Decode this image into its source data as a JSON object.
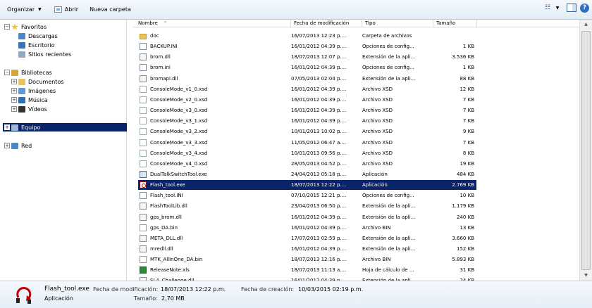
{
  "toolbar": {
    "organize": "Organizar",
    "open": "Abrir",
    "new_folder": "Nueva carpeta"
  },
  "nav": {
    "favorites": "Favoritos",
    "downloads": "Descargas",
    "desktop": "Escritorio",
    "recent": "Sitios recientes",
    "libraries": "Bibliotecas",
    "documents": "Documentos",
    "images": "Imágenes",
    "music": "Música",
    "videos": "Vídeos",
    "computer": "Equipo",
    "network": "Red"
  },
  "columns": {
    "name": "Nombre",
    "date": "Fecha de modificación",
    "type": "Tipo",
    "size": "Tamaño"
  },
  "files": [
    {
      "name": "doc",
      "date": "16/07/2013 12:23 p....",
      "type": "Carpeta de archivos",
      "size": "",
      "icon": "folder-icon"
    },
    {
      "name": "BACKUP.INI",
      "date": "16/01/2012 04:39 p....",
      "type": "Opciones de config...",
      "size": "1 KB",
      "icon": "ini-file-icon"
    },
    {
      "name": "brom.dll",
      "date": "18/07/2013 12:07 p....",
      "type": "Extensión de la apli...",
      "size": "3.536 KB",
      "icon": "dll-file-icon"
    },
    {
      "name": "brom.ini",
      "date": "16/01/2012 04:39 p....",
      "type": "Opciones de config...",
      "size": "1 KB",
      "icon": "ini-file-icon"
    },
    {
      "name": "bromapi.dll",
      "date": "07/05/2013 02:04 p....",
      "type": "Extensión de la apli...",
      "size": "88 KB",
      "icon": "dll-file-icon"
    },
    {
      "name": "ConsoleMode_v1_0.xsd",
      "date": "16/01/2012 04:39 p....",
      "type": "Archivo XSD",
      "size": "12 KB",
      "icon": "xsd-file-icon"
    },
    {
      "name": "ConsoleMode_v2_0.xsd",
      "date": "16/01/2012 04:39 p....",
      "type": "Archivo XSD",
      "size": "7 KB",
      "icon": "xsd-file-icon"
    },
    {
      "name": "ConsoleMode_v3_0.xsd",
      "date": "16/01/2012 04:39 p....",
      "type": "Archivo XSD",
      "size": "7 KB",
      "icon": "xsd-file-icon"
    },
    {
      "name": "ConsoleMode_v3_1.xsd",
      "date": "16/01/2012 04:39 p....",
      "type": "Archivo XSD",
      "size": "7 KB",
      "icon": "xsd-file-icon"
    },
    {
      "name": "ConsoleMode_v3_2.xsd",
      "date": "10/01/2013 10:02 p....",
      "type": "Archivo XSD",
      "size": "9 KB",
      "icon": "xsd-file-icon"
    },
    {
      "name": "ConsoleMode_v3_3.xsd",
      "date": "11/05/2012 06:47 a....",
      "type": "Archivo XSD",
      "size": "7 KB",
      "icon": "xsd-file-icon"
    },
    {
      "name": "ConsoleMode_v3_4.xsd",
      "date": "10/01/2013 09:56 p....",
      "type": "Archivo XSD",
      "size": "8 KB",
      "icon": "xsd-file-icon"
    },
    {
      "name": "ConsoleMode_v4_0.xsd",
      "date": "28/05/2013 04:52 p....",
      "type": "Archivo XSD",
      "size": "19 KB",
      "icon": "xsd-file-icon"
    },
    {
      "name": "DualTalkSwitchTool.exe",
      "date": "24/04/2013 05:18 p....",
      "type": "Aplicación",
      "size": "484 KB",
      "icon": "exe-file-icon"
    },
    {
      "name": "Flash_tool.exe",
      "date": "18/07/2013 12:22 p....",
      "type": "Aplicación",
      "size": "2.769 KB",
      "icon": "flash-tool-icon",
      "selected": true
    },
    {
      "name": "Flash_tool.INI",
      "date": "07/10/2015 12:21 p....",
      "type": "Opciones de config...",
      "size": "10 KB",
      "icon": "ini-file-icon"
    },
    {
      "name": "FlashToolLib.dll",
      "date": "23/04/2013 06:50 p....",
      "type": "Extensión de la apli...",
      "size": "1.179 KB",
      "icon": "dll-file-icon"
    },
    {
      "name": "gps_brom.dll",
      "date": "16/01/2012 04:39 p....",
      "type": "Extensión de la apli...",
      "size": "240 KB",
      "icon": "dll-file-icon"
    },
    {
      "name": "gps_DA.bin",
      "date": "16/01/2012 04:39 p....",
      "type": "Archivo BIN",
      "size": "13 KB",
      "icon": "bin-file-icon"
    },
    {
      "name": "META_DLL.dll",
      "date": "17/07/2013 02:59 p....",
      "type": "Extensión de la apli...",
      "size": "3.660 KB",
      "icon": "dll-file-icon"
    },
    {
      "name": "mredll.dll",
      "date": "16/01/2012 04:39 p....",
      "type": "Extensión de la apli...",
      "size": "152 KB",
      "icon": "dll-file-icon"
    },
    {
      "name": "MTK_AllInOne_DA.bin",
      "date": "18/07/2013 12:16 p....",
      "type": "Archivo BIN",
      "size": "5.893 KB",
      "icon": "bin-file-icon"
    },
    {
      "name": "ReleaseNote.xls",
      "date": "18/07/2013 11:13 a....",
      "type": "Hoja de cálculo de ...",
      "size": "31 KB",
      "icon": "xls-file-icon"
    },
    {
      "name": "SLA_Challenge.dll",
      "date": "16/01/2012 04:39 p....",
      "type": "Extensión de la apli...",
      "size": "24 KB",
      "icon": "dll-file-icon"
    }
  ],
  "details": {
    "file_name": "Flash_tool.exe",
    "file_type": "Aplicación",
    "modified_label": "Fecha de modificación:",
    "modified_value": "18/07/2013 12:22 p.m.",
    "created_label": "Fecha de creación:",
    "created_value": "10/03/2015 02:19 p.m.",
    "size_label": "Tamaño:",
    "size_value": "2,70 MB"
  }
}
